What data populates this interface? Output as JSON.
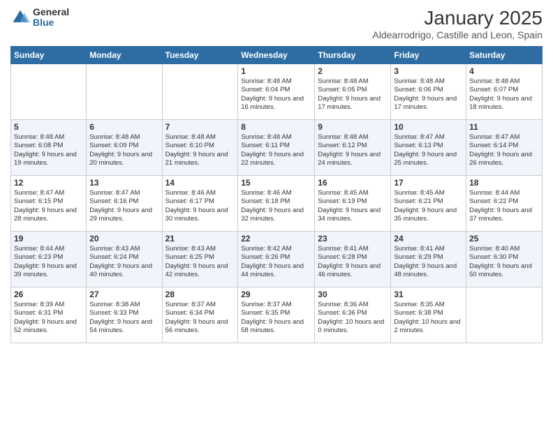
{
  "logo": {
    "general": "General",
    "blue": "Blue"
  },
  "title": "January 2025",
  "subtitle": "Aldearrodrigo, Castille and Leon, Spain",
  "days_header": [
    "Sunday",
    "Monday",
    "Tuesday",
    "Wednesday",
    "Thursday",
    "Friday",
    "Saturday"
  ],
  "weeks": [
    [
      {
        "day": "",
        "info": ""
      },
      {
        "day": "",
        "info": ""
      },
      {
        "day": "",
        "info": ""
      },
      {
        "day": "1",
        "info": "Sunrise: 8:48 AM\nSunset: 6:04 PM\nDaylight: 9 hours and 16 minutes."
      },
      {
        "day": "2",
        "info": "Sunrise: 8:48 AM\nSunset: 6:05 PM\nDaylight: 9 hours and 17 minutes."
      },
      {
        "day": "3",
        "info": "Sunrise: 8:48 AM\nSunset: 6:06 PM\nDaylight: 9 hours and 17 minutes."
      },
      {
        "day": "4",
        "info": "Sunrise: 8:48 AM\nSunset: 6:07 PM\nDaylight: 9 hours and 18 minutes."
      }
    ],
    [
      {
        "day": "5",
        "info": "Sunrise: 8:48 AM\nSunset: 6:08 PM\nDaylight: 9 hours and 19 minutes."
      },
      {
        "day": "6",
        "info": "Sunrise: 8:48 AM\nSunset: 6:09 PM\nDaylight: 9 hours and 20 minutes."
      },
      {
        "day": "7",
        "info": "Sunrise: 8:48 AM\nSunset: 6:10 PM\nDaylight: 9 hours and 21 minutes."
      },
      {
        "day": "8",
        "info": "Sunrise: 8:48 AM\nSunset: 6:11 PM\nDaylight: 9 hours and 22 minutes."
      },
      {
        "day": "9",
        "info": "Sunrise: 8:48 AM\nSunset: 6:12 PM\nDaylight: 9 hours and 24 minutes."
      },
      {
        "day": "10",
        "info": "Sunrise: 8:47 AM\nSunset: 6:13 PM\nDaylight: 9 hours and 25 minutes."
      },
      {
        "day": "11",
        "info": "Sunrise: 8:47 AM\nSunset: 6:14 PM\nDaylight: 9 hours and 26 minutes."
      }
    ],
    [
      {
        "day": "12",
        "info": "Sunrise: 8:47 AM\nSunset: 6:15 PM\nDaylight: 9 hours and 28 minutes."
      },
      {
        "day": "13",
        "info": "Sunrise: 8:47 AM\nSunset: 6:16 PM\nDaylight: 9 hours and 29 minutes."
      },
      {
        "day": "14",
        "info": "Sunrise: 8:46 AM\nSunset: 6:17 PM\nDaylight: 9 hours and 30 minutes."
      },
      {
        "day": "15",
        "info": "Sunrise: 8:46 AM\nSunset: 6:18 PM\nDaylight: 9 hours and 32 minutes."
      },
      {
        "day": "16",
        "info": "Sunrise: 8:45 AM\nSunset: 6:19 PM\nDaylight: 9 hours and 34 minutes."
      },
      {
        "day": "17",
        "info": "Sunrise: 8:45 AM\nSunset: 6:21 PM\nDaylight: 9 hours and 35 minutes."
      },
      {
        "day": "18",
        "info": "Sunrise: 8:44 AM\nSunset: 6:22 PM\nDaylight: 9 hours and 37 minutes."
      }
    ],
    [
      {
        "day": "19",
        "info": "Sunrise: 8:44 AM\nSunset: 6:23 PM\nDaylight: 9 hours and 39 minutes."
      },
      {
        "day": "20",
        "info": "Sunrise: 8:43 AM\nSunset: 6:24 PM\nDaylight: 9 hours and 40 minutes."
      },
      {
        "day": "21",
        "info": "Sunrise: 8:43 AM\nSunset: 6:25 PM\nDaylight: 9 hours and 42 minutes."
      },
      {
        "day": "22",
        "info": "Sunrise: 8:42 AM\nSunset: 6:26 PM\nDaylight: 9 hours and 44 minutes."
      },
      {
        "day": "23",
        "info": "Sunrise: 8:41 AM\nSunset: 6:28 PM\nDaylight: 9 hours and 46 minutes."
      },
      {
        "day": "24",
        "info": "Sunrise: 8:41 AM\nSunset: 6:29 PM\nDaylight: 9 hours and 48 minutes."
      },
      {
        "day": "25",
        "info": "Sunrise: 8:40 AM\nSunset: 6:30 PM\nDaylight: 9 hours and 50 minutes."
      }
    ],
    [
      {
        "day": "26",
        "info": "Sunrise: 8:39 AM\nSunset: 6:31 PM\nDaylight: 9 hours and 52 minutes."
      },
      {
        "day": "27",
        "info": "Sunrise: 8:38 AM\nSunset: 6:33 PM\nDaylight: 9 hours and 54 minutes."
      },
      {
        "day": "28",
        "info": "Sunrise: 8:37 AM\nSunset: 6:34 PM\nDaylight: 9 hours and 56 minutes."
      },
      {
        "day": "29",
        "info": "Sunrise: 8:37 AM\nSunset: 6:35 PM\nDaylight: 9 hours and 58 minutes."
      },
      {
        "day": "30",
        "info": "Sunrise: 8:36 AM\nSunset: 6:36 PM\nDaylight: 10 hours and 0 minutes."
      },
      {
        "day": "31",
        "info": "Sunrise: 8:35 AM\nSunset: 6:38 PM\nDaylight: 10 hours and 2 minutes."
      },
      {
        "day": "",
        "info": ""
      }
    ]
  ]
}
